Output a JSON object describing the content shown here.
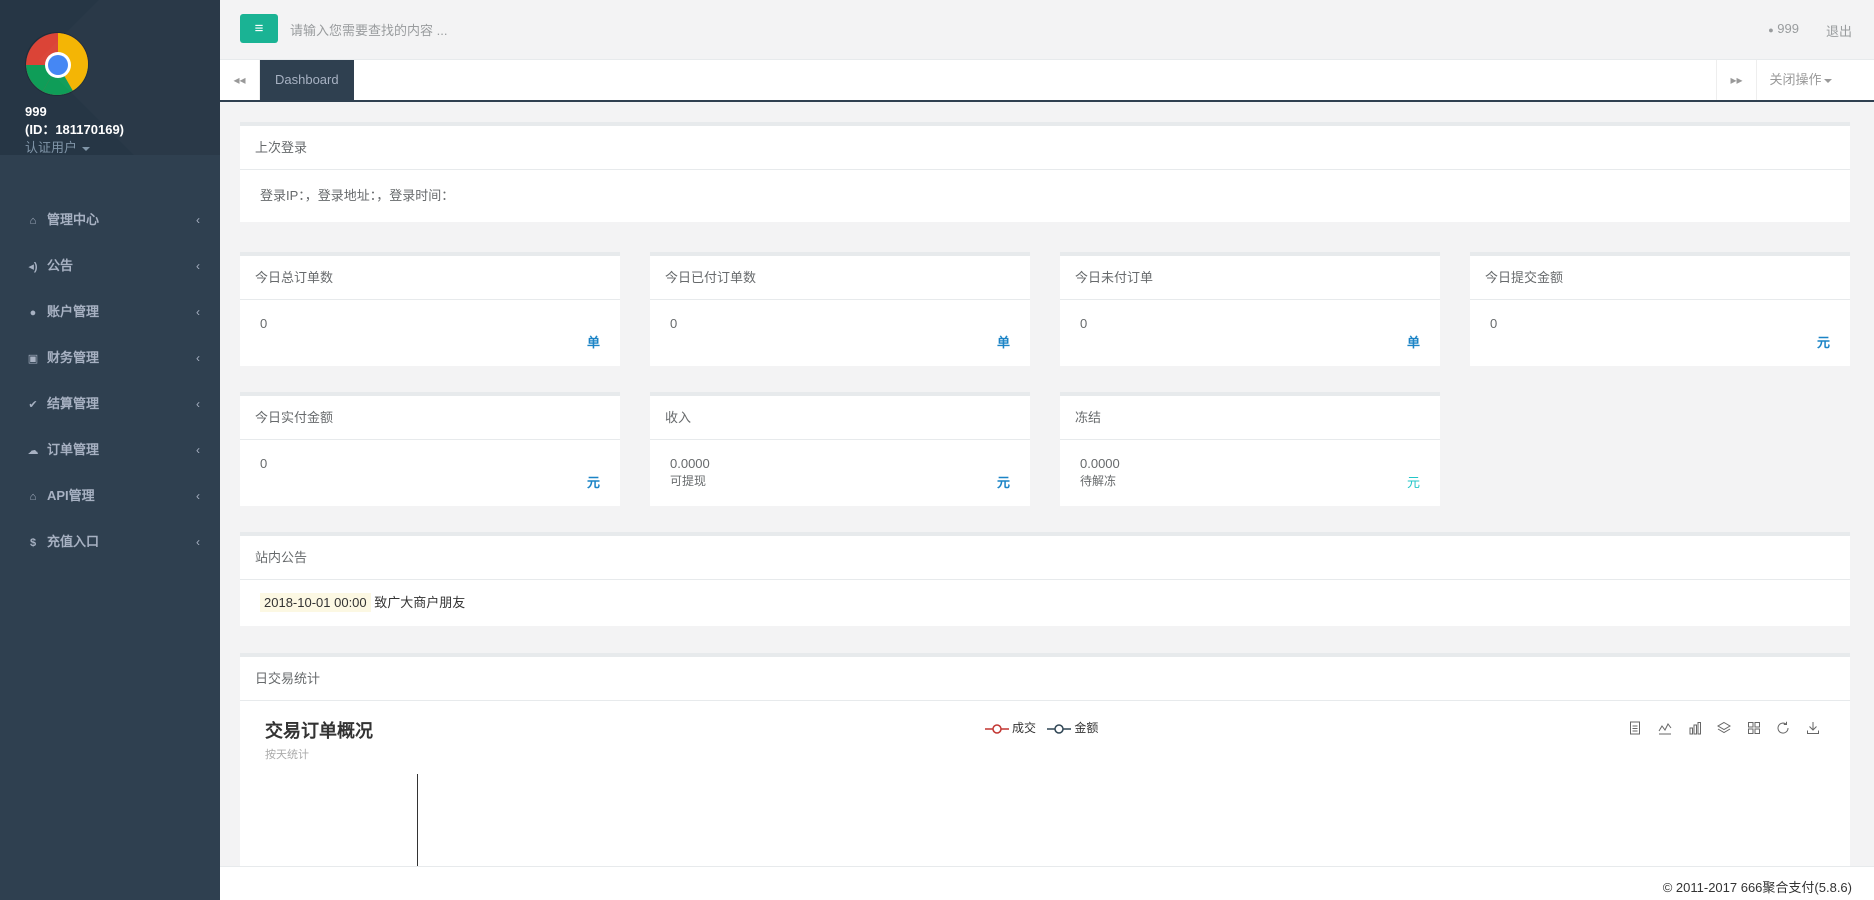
{
  "profile": {
    "name": "999",
    "id_line": "(ID：181170169)",
    "role": "认证用户"
  },
  "nav": [
    {
      "label": "管理中心",
      "icon": "home-icon",
      "glyph": "⌂",
      "arrow": "‹"
    },
    {
      "label": "公告",
      "icon": "volume-icon",
      "glyph": "◂)",
      "arrow": "‹"
    },
    {
      "label": "账户管理",
      "icon": "user-icon",
      "glyph": "●",
      "arrow": "‹"
    },
    {
      "label": "财务管理",
      "icon": "money-icon",
      "glyph": "▣",
      "arrow": "‹"
    },
    {
      "label": "结算管理",
      "icon": "check-icon",
      "glyph": "✔",
      "arrow": "‹"
    },
    {
      "label": "订单管理",
      "icon": "cloud-icon",
      "glyph": "☁",
      "arrow": "‹"
    },
    {
      "label": "API管理",
      "icon": "bank-icon",
      "glyph": "⌂",
      "arrow": "‹"
    },
    {
      "label": "充值入口",
      "icon": "dollar-icon",
      "glyph": "$",
      "arrow": "‹"
    }
  ],
  "topbar": {
    "menu_glyph": "≡",
    "search_placeholder": "请输入您需要查找的内容 ...",
    "user_label": "999",
    "user_glyph": "●",
    "logout_label": "退出"
  },
  "tabs": {
    "back_glyph": "◂◂",
    "active_label": "Dashboard",
    "forward_glyph": "▸▸",
    "close_label": "关闭操作"
  },
  "last_login": {
    "title": "上次登录",
    "text": "登录IP：，登录地址：，登录时间："
  },
  "stats_row1": [
    {
      "title": "今日总订单数",
      "value": "0",
      "unit": "单"
    },
    {
      "title": "今日已付订单数",
      "value": "0",
      "unit": "单"
    },
    {
      "title": "今日未付订单",
      "value": "0",
      "unit": "单"
    },
    {
      "title": "今日提交金额",
      "value": "0",
      "unit": "元"
    }
  ],
  "stats_row2": [
    {
      "title": "今日实付金额",
      "value": "0",
      "sub": "",
      "unit": "元"
    },
    {
      "title": "收入",
      "value": "0.0000",
      "sub": "可提现",
      "unit": "元"
    },
    {
      "title": "冻结",
      "value": "0.0000",
      "sub": "待解冻",
      "unit": "元"
    }
  ],
  "notice": {
    "title": "站内公告",
    "date": "2018-10-01 00:00",
    "text": "致广大商户朋友"
  },
  "daily_stats": {
    "title": "日交易统计",
    "chart_title": "交易订单概况",
    "chart_subtitle": "按天统计",
    "legend": [
      {
        "name": "成交",
        "color": "#c23531"
      },
      {
        "name": "金额",
        "color": "#2f4554"
      }
    ],
    "tools": [
      "data-view-icon",
      "line-chart-icon",
      "bar-chart-icon",
      "stack-icon",
      "tiled-icon",
      "restore-icon",
      "save-image-icon"
    ]
  },
  "footer": {
    "text": "© 2011-2017 666聚合支付(5.8.6)"
  },
  "colors": {
    "sidebar": "#2f4050",
    "accent": "#1ab394",
    "unit_blue": "#1c84c6",
    "unit_cyan": "#23c6c8"
  }
}
